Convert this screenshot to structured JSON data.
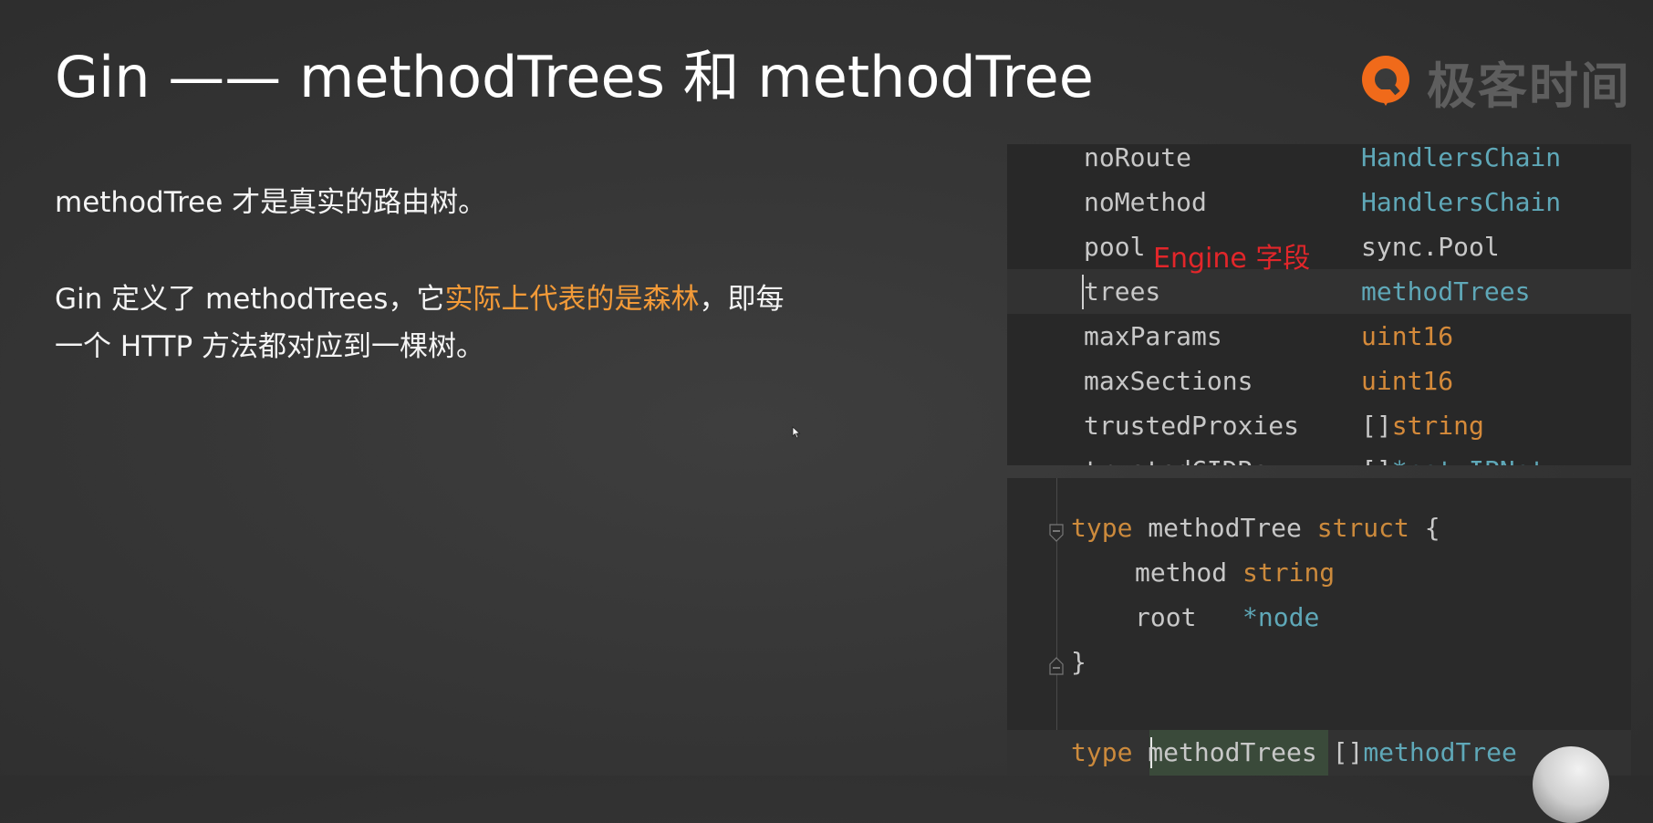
{
  "slide": {
    "title": "Gin —— methodTrees 和 methodTree",
    "brand_text": "极客时间",
    "para1": "methodTree 才是真实的路由树。",
    "para2_a": "Gin 定义了 methodTrees，它",
    "para2_hl": "实际上代表的是森林",
    "para2_b": "，即每",
    "para2_c": "一个 HTTP 方法都对应到一棵树。",
    "highlight_color": "#f29a38",
    "title_color": "#ffffff",
    "brand_color": "#f06a1a"
  },
  "engine_fields": {
    "annotation": "Engine 字段",
    "annotation_color": "#e2262a",
    "rows": [
      {
        "name": "noRoute",
        "type_prefix": "",
        "type": "HandlersChain",
        "color": "blue"
      },
      {
        "name": "noMethod",
        "type_prefix": "",
        "type": "HandlersChain",
        "color": "blue"
      },
      {
        "name": "pool",
        "type_prefix": "",
        "type": "sync.Pool",
        "color": "plain"
      },
      {
        "name": "trees",
        "type_prefix": "",
        "type": "methodTrees",
        "color": "blue"
      },
      {
        "name": "maxParams",
        "type_prefix": "",
        "type": "uint16",
        "color": "orange"
      },
      {
        "name": "maxSections",
        "type_prefix": "",
        "type": "uint16",
        "color": "orange"
      },
      {
        "name": "trustedProxies",
        "type_prefix": "[]",
        "type": "string",
        "color": "orange"
      },
      {
        "name": "trustedCIDRs",
        "type_prefix": "[]",
        "type": "*net.IPNet",
        "color": "blue"
      }
    ]
  },
  "code": {
    "kw_type": "type",
    "tree_name": "methodTree",
    "kw_struct": "struct",
    "open_brace": "{",
    "f1_name": "method",
    "f1_type": "string",
    "f2_name": "root",
    "f2_type": "*node",
    "close_brace": "}",
    "kw_type2": "type",
    "trees_name": "methodTrees",
    "trees_prefix": "[]",
    "trees_elem": "methodTree"
  }
}
